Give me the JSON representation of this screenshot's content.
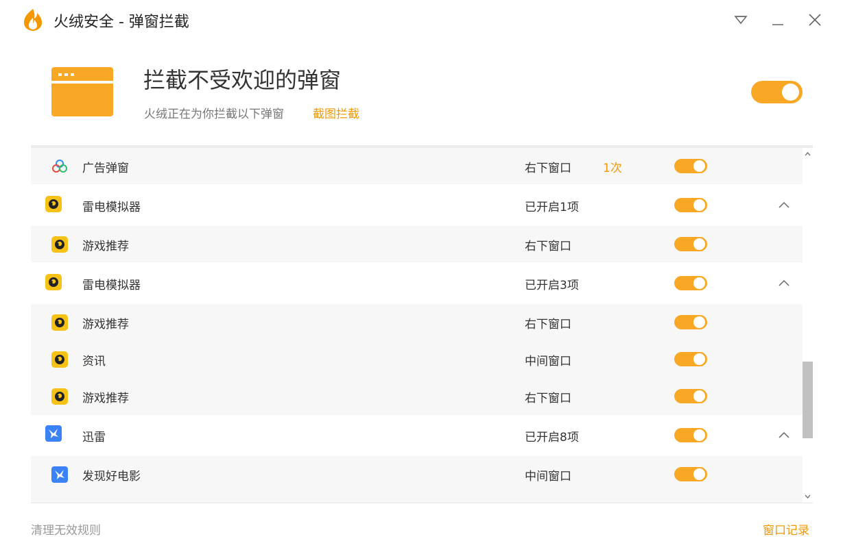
{
  "window": {
    "title": "火绒安全 - 弹窗拦截",
    "logo_icon": "huorong-flame-icon",
    "controls": [
      "menu-triangle-icon",
      "minimize-icon",
      "close-icon"
    ]
  },
  "header": {
    "icon": "browser-window-icon",
    "title": "拦截不受欢迎的弹窗",
    "subtitle": "火绒正在为你拦截以下弹窗",
    "link": "截图拦截",
    "master_toggle": "on"
  },
  "colors": {
    "accent": "#f9a825",
    "link": "#f39800",
    "sub_row_bg": "#f7f7f7"
  },
  "rows": [
    {
      "type": "sub",
      "icon": "baidu-cloud-icon",
      "name": "广告弹窗",
      "location": "右下窗口",
      "count": "1次",
      "toggle": "on"
    },
    {
      "type": "parent",
      "icon": "leidian-emulator-icon",
      "name": "雷电模拟器",
      "location": "已开启1项",
      "toggle": "on",
      "expanded": true
    },
    {
      "type": "sub",
      "icon": "leidian-emulator-icon",
      "name": "游戏推荐",
      "location": "右下窗口",
      "toggle": "on"
    },
    {
      "type": "parent",
      "icon": "leidian-emulator-icon",
      "name": "雷电模拟器",
      "location": "已开启3项",
      "toggle": "on",
      "expanded": true
    },
    {
      "type": "sub",
      "icon": "leidian-emulator-icon",
      "name": "游戏推荐",
      "location": "右下窗口",
      "toggle": "on"
    },
    {
      "type": "sub",
      "icon": "leidian-emulator-icon",
      "name": "资讯",
      "location": "中间窗口",
      "toggle": "on"
    },
    {
      "type": "sub",
      "icon": "leidian-emulator-icon",
      "name": "游戏推荐",
      "location": "右下窗口",
      "toggle": "on"
    },
    {
      "type": "parent",
      "icon": "xunlei-bird-icon",
      "name": "迅雷",
      "location": "已开启8项",
      "toggle": "on",
      "expanded": true
    },
    {
      "type": "sub",
      "icon": "xunlei-bird-icon",
      "name": "发现好电影",
      "location": "中间窗口",
      "toggle": "on"
    }
  ],
  "footer": {
    "left": "清理无效规则",
    "right": "窗口记录"
  }
}
